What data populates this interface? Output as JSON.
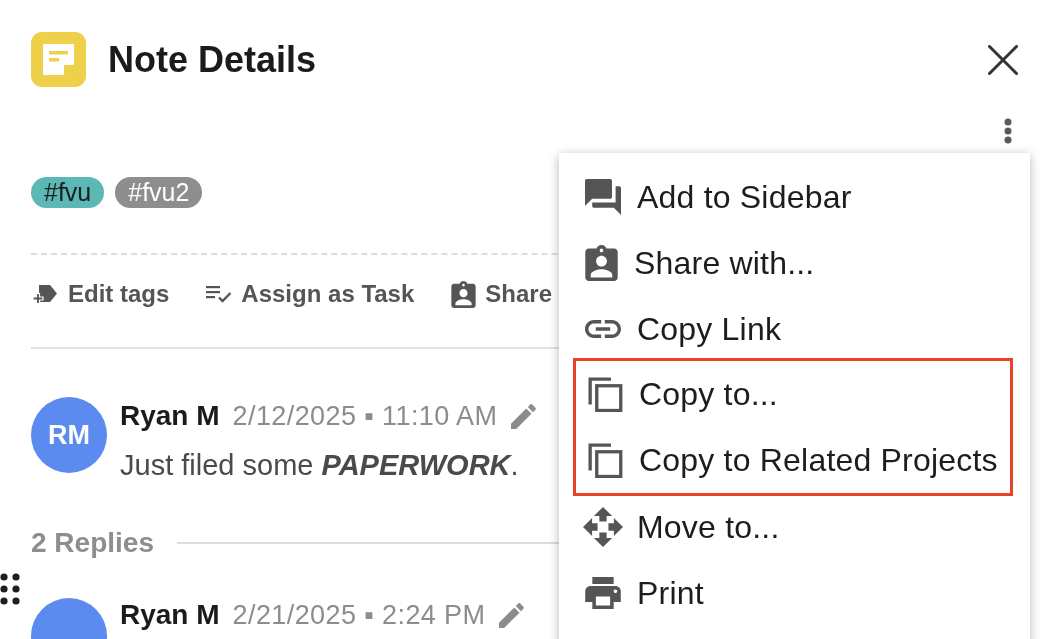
{
  "header": {
    "title": "Note Details"
  },
  "tags": [
    {
      "label": "#fvu",
      "color": "#5bb8b4"
    },
    {
      "label": "#fvu2",
      "color": "#8e8e8e"
    }
  ],
  "actions": [
    {
      "kind": "tag",
      "label": "Edit tags"
    },
    {
      "kind": "task",
      "label": "Assign as Task"
    },
    {
      "kind": "share",
      "label": "Share"
    }
  ],
  "comment": {
    "avatar": "RM",
    "author": "Ryan M",
    "time": "2/12/2025 ▪ 11:10 AM",
    "text": "Just filed some **PAPERWORK**."
  },
  "replies": {
    "label": "2 Replies",
    "items": [
      {
        "author": "Ryan M",
        "time": "2/21/2025 ▪ 2:24 PM"
      }
    ]
  },
  "menu": {
    "items": [
      {
        "kind": "sidebar",
        "label": "Add to Sidebar",
        "highlighted": false
      },
      {
        "kind": "share",
        "label": "Share with...",
        "highlighted": false
      },
      {
        "kind": "link",
        "label": "Copy Link",
        "highlighted": false
      },
      {
        "kind": "copy",
        "label": "Copy to...",
        "highlighted": true
      },
      {
        "kind": "copy",
        "label": "Copy to Related Projects",
        "highlighted": true
      },
      {
        "kind": "move",
        "label": "Move to...",
        "highlighted": false
      },
      {
        "kind": "print",
        "label": "Print",
        "highlighted": false
      }
    ]
  }
}
